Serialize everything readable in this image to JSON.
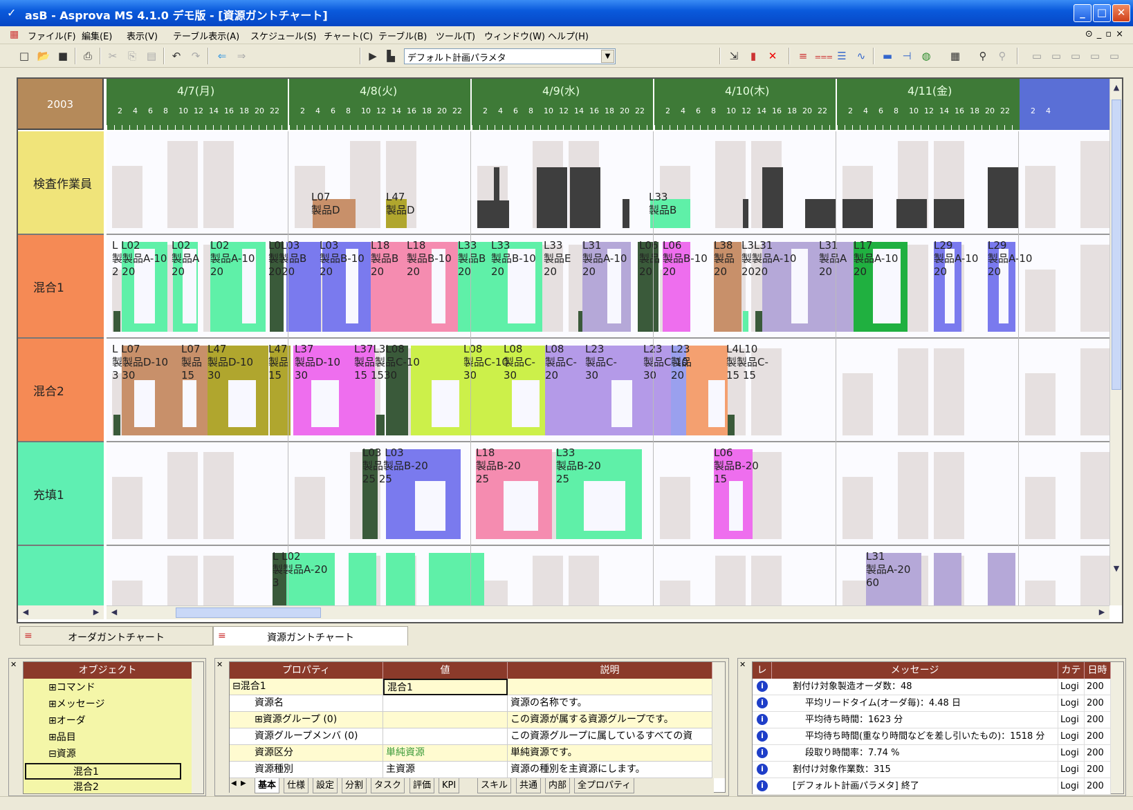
{
  "window": {
    "title": "asB - Asprova MS 4.1.0 デモ版 - [資源ガントチャート]",
    "app_icon": "asprova-icon"
  },
  "menu": [
    "ファイル(F)",
    "編集(E)",
    "表示(V)",
    "テーブル表示(A)",
    "スケジュール(S)",
    "チャート(C)",
    "テーブル(B)",
    "ツール(T)",
    "ウィンドウ(W)",
    "ヘルプ(H)"
  ],
  "toolbar": {
    "param_select": "デフォルト計画パラメタ"
  },
  "gantt": {
    "year": "2003",
    "days": [
      "4/7(月)",
      "4/8(火)",
      "4/9(水)",
      "4/10(木)",
      "4/11(金)"
    ],
    "hours": [
      "2",
      "4",
      "6",
      "8",
      "10",
      "12",
      "14",
      "16",
      "18",
      "20",
      "22"
    ],
    "rows": [
      "検査作業員",
      "混合1",
      "混合2",
      "充填1",
      ""
    ],
    "row_colors": [
      "#f0e47a",
      "#f58a55",
      "#f58a55",
      "#5fefb2",
      "#5fefb2"
    ],
    "labels": {
      "r0": [
        "L07\n製品D",
        "L47\n製品D",
        "L33\n製品B"
      ],
      "r1": [
        "L L02\n製製品A-10\n2 20",
        "L02\n製品A\n20",
        "L02\n製品A-10\n20",
        "L0L03\n製製品B\n2020",
        "L03\n製品B-10\n20",
        "L18\n製品B\n20",
        "L18\n製品B-10\n20",
        "L33\n製品B\n20",
        "L33\n製品B-10\n20",
        "L33\n製品E\n20",
        "L31\n製品A-10\n20",
        "L06\n製品\n20",
        "L06\n製品B-10\n20",
        "L38\n製品\n20",
        "L3L31\n製製品A-10\n2020",
        "L31\n製品A\n20",
        "L17\n製品A-10\n20",
        "L29\n製品A-10\n20",
        "L29\n製品A-10\n20"
      ],
      "r2": [
        "L L07\n製製品D-10\n3 30",
        "L07\n製品\n15",
        "L47\n製品D-10\n30",
        "L47\n製品\n15",
        "L37\n製品D-10\n30",
        "L37L3L08\n製品製品C-10\n15 1530",
        "L08\n製品C-10\n30",
        "L08\n製品C-\n30",
        "L08\n製品C-\n20",
        "L23\n製品C-\n30",
        "L23\n製品C-10\n30",
        "L23\n製品\n20",
        "L4L10\n製製品C-\n15 15",
        "L10\n製品C-10\n15"
      ],
      "r3": [
        "L03 L03\n製品製品B-20\n25 25",
        "L18\n製品B-20\n25",
        "L33\n製品B-20\n25",
        "L06\n製品B-20\n15"
      ],
      "r4": [
        "L L02\n製製品A-20\n3",
        "L31\n製品A-20\n60"
      ]
    }
  },
  "chart_tabs": [
    "オーダガントチャート",
    "資源ガントチャート"
  ],
  "object_panel": {
    "header": "オブジェクト",
    "items": [
      "⊞コマンド",
      "⊞メッセージ",
      "⊞オーダ",
      "⊞品目",
      "⊟資源",
      "混合1",
      "混合2"
    ]
  },
  "property_panel": {
    "headers": [
      "プロパティ",
      "値",
      "説明"
    ],
    "rows": [
      [
        "⊟混合1",
        "混合1",
        ""
      ],
      [
        "資源名",
        "",
        "資源の名称です。"
      ],
      [
        "⊞資源グループ (0)",
        "",
        "この資源が属する資源グループです。"
      ],
      [
        "資源グループメンバ (0)",
        "",
        "この資源グループに属しているすべての資"
      ],
      [
        "資源区分",
        "単純資源",
        "単純資源です。"
      ],
      [
        "資源種別",
        "主資源",
        "資源の種別を主資源にします。"
      ]
    ],
    "tabs": [
      "基本",
      "仕様",
      "設定",
      "分割",
      "タスク",
      "評価",
      "KPI",
      "スキル",
      "共通",
      "内部",
      "全プロパティ"
    ]
  },
  "message_panel": {
    "headers": [
      "レ",
      "メッセージ",
      "カテ",
      "日時"
    ],
    "rows": [
      [
        "割付け対象製造オーダ数：48",
        "Logi",
        "200"
      ],
      [
        "平均リードタイム(オーダ毎)：4.48 日",
        "Logi",
        "200"
      ],
      [
        "平均待ち時間：1623 分",
        "Logi",
        "200"
      ],
      [
        "平均待ち時間(重なり時間などを差し引いたもの)：1518 分",
        "Logi",
        "200"
      ],
      [
        "段取り時間率：7.74 %",
        "Logi",
        "200"
      ],
      [
        "割付け対象作業数：315",
        "Logi",
        "200"
      ],
      [
        "[デフォルト計画パラメタ] 終了",
        "Logi",
        "200"
      ]
    ]
  }
}
